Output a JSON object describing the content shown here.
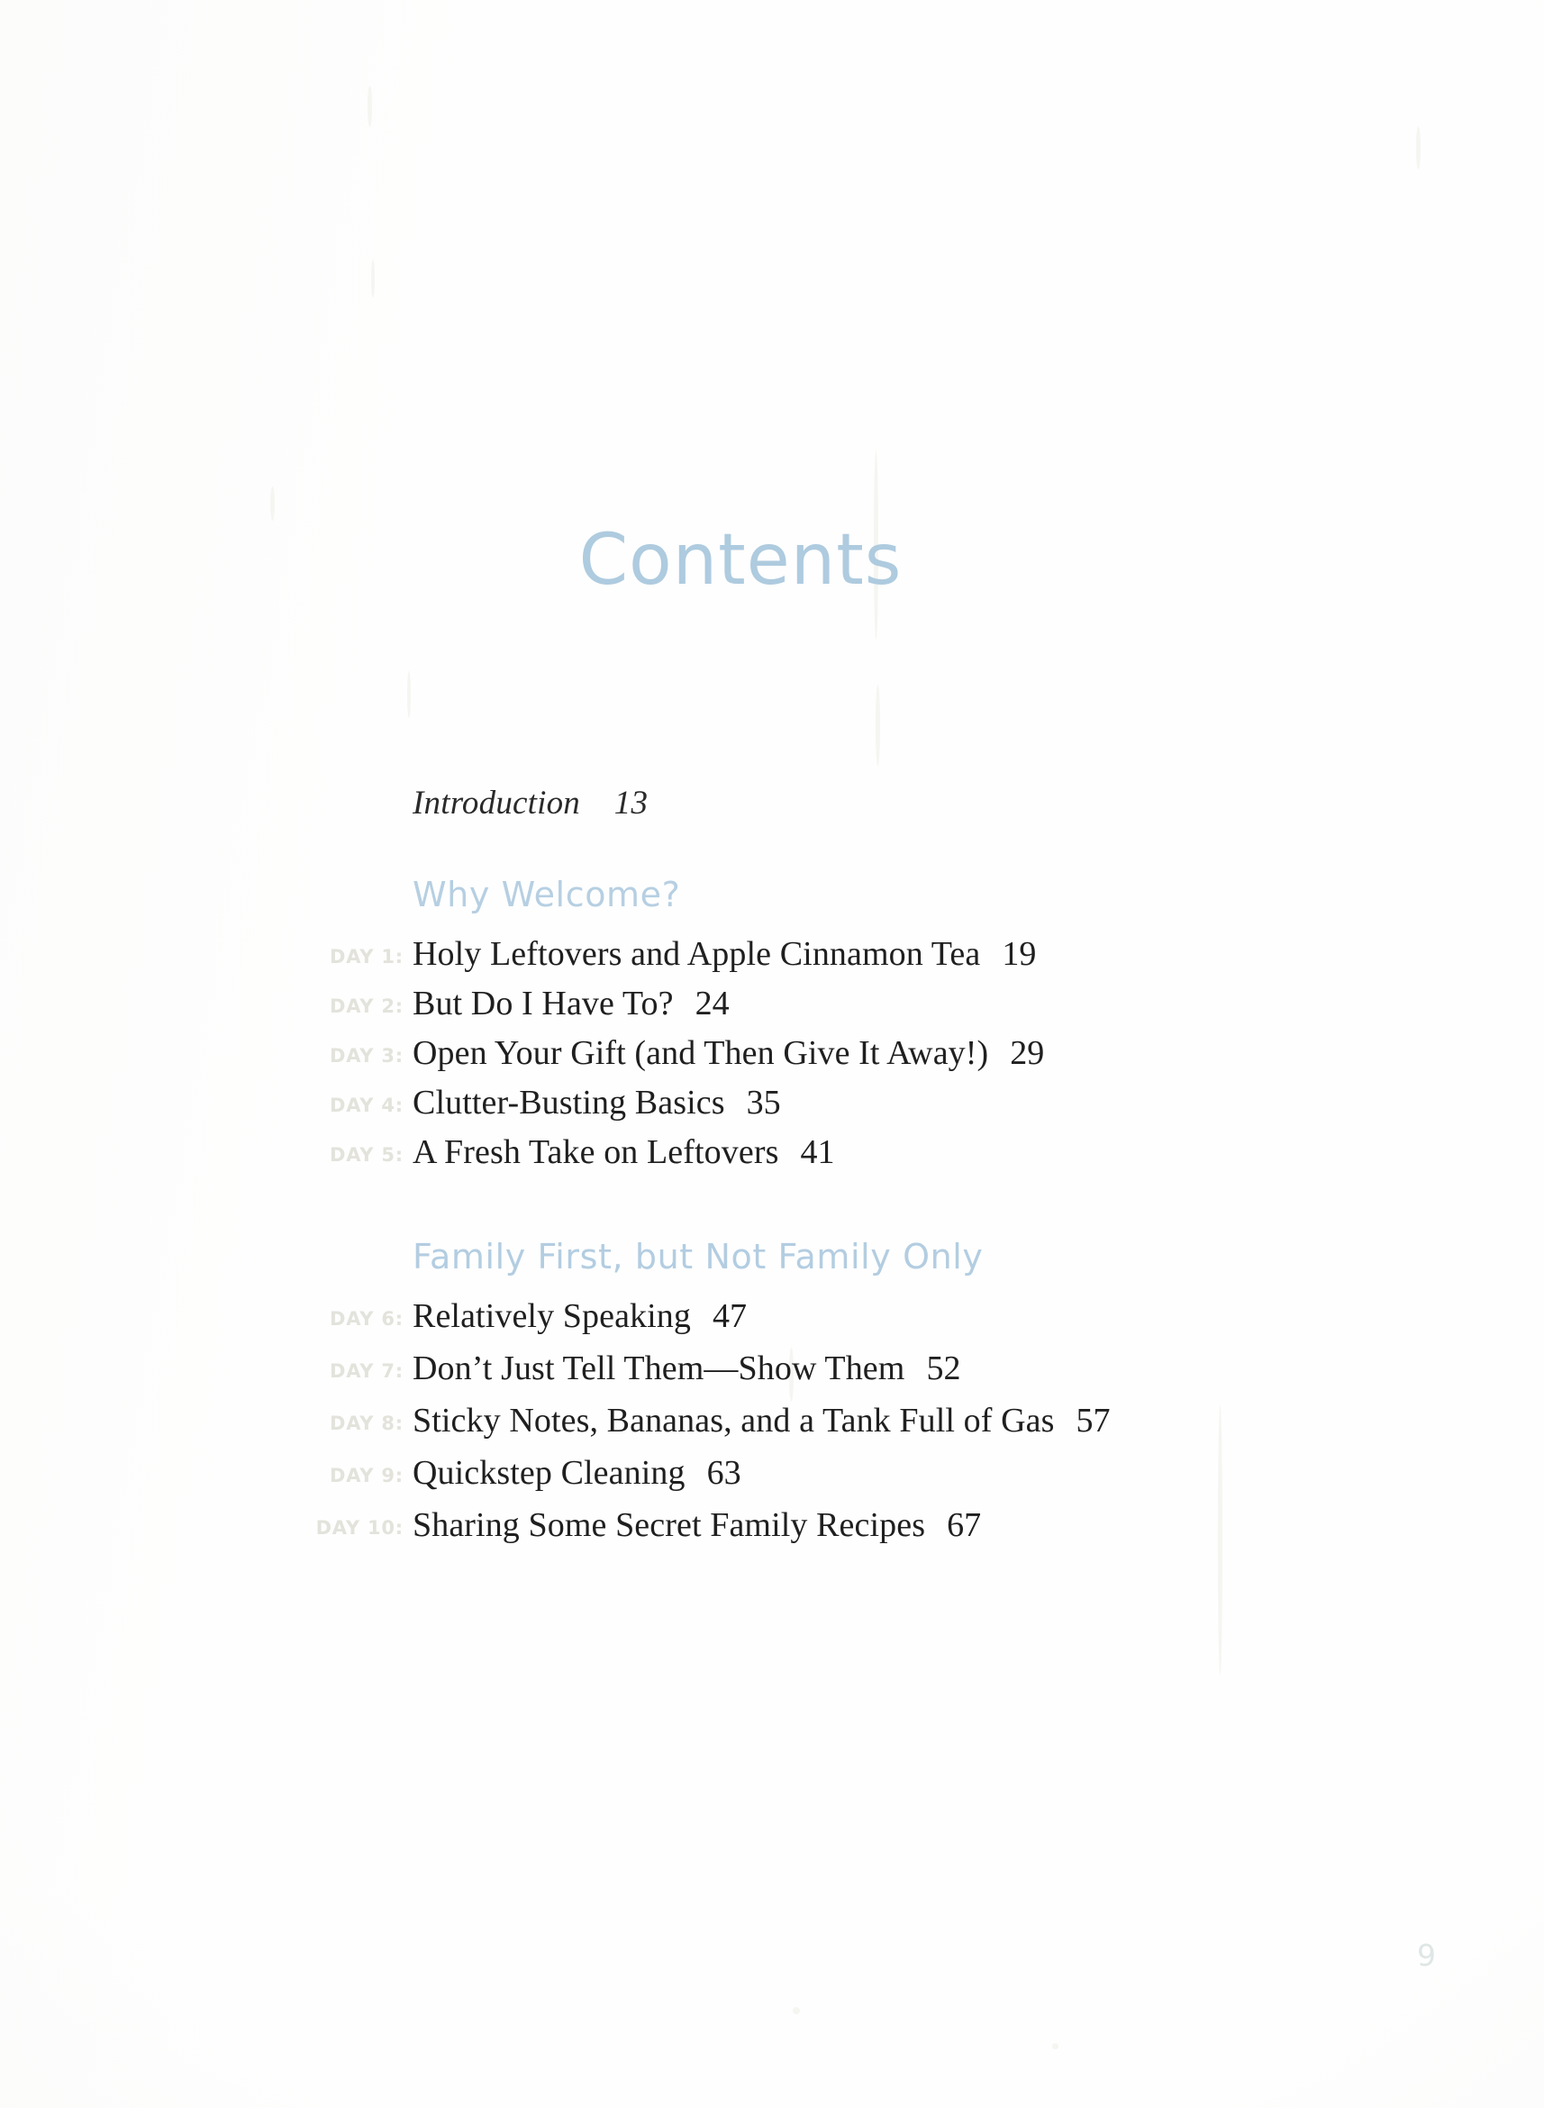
{
  "page": {
    "title": "Contents",
    "folio": "9",
    "accent_color": "#a8c7dd",
    "day_label_color": "#e3e3dc",
    "body_color": "#1f1f1f"
  },
  "intro": {
    "label": "Introduction",
    "page": "13",
    "line": "Introduction    13"
  },
  "sections": [
    {
      "heading": "Why Welcome?",
      "entries": [
        {
          "day": "DAY 1:",
          "title": "Holy Leftovers and Apple Cinnamon Tea",
          "page": "19"
        },
        {
          "day": "DAY 2:",
          "title": "But Do I Have To?",
          "page": "24"
        },
        {
          "day": "DAY 3:",
          "title": "Open Your Gift (and Then Give It Away!)",
          "page": "29"
        },
        {
          "day": "DAY 4:",
          "title": "Clutter-Busting Basics",
          "page": "35"
        },
        {
          "day": "DAY 5:",
          "title": "A Fresh Take on Leftovers",
          "page": "41"
        }
      ]
    },
    {
      "heading": "Family First, but Not Family Only",
      "entries": [
        {
          "day": "DAY 6:",
          "title": "Relatively Speaking",
          "page": "47"
        },
        {
          "day": "DAY 7:",
          "title": "Don’t Just Tell Them—Show Them",
          "page": "52"
        },
        {
          "day": "DAY 8:",
          "title": "Sticky Notes, Bananas, and a Tank Full of Gas",
          "page": "57"
        },
        {
          "day": "DAY 9:",
          "title": "Quickstep Cleaning",
          "page": "63"
        },
        {
          "day": "DAY 10:",
          "title": "Sharing Some Secret Family Recipes",
          "page": "67"
        }
      ]
    }
  ]
}
